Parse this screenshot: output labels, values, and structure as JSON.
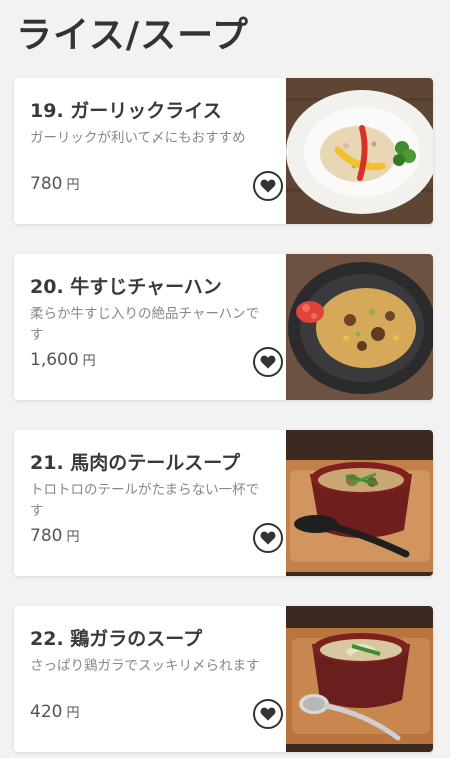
{
  "page": {
    "title": "ライス/スープ"
  },
  "menu": {
    "items": [
      {
        "name": "19. ガーリックライス",
        "description": "ガーリックが利いて〆にもおすすめ",
        "price": "780",
        "unit": "円",
        "photo": "garlic-rice-photo",
        "fav_icon": "heart-icon"
      },
      {
        "name": "20. 牛すじチャーハン",
        "description": "柔らか牛すじ入りの絶品チャーハンです",
        "price": "1,600",
        "unit": "円",
        "photo": "beef-fried-rice-photo",
        "fav_icon": "heart-icon"
      },
      {
        "name": "21. 馬肉のテールスープ",
        "description": "トロトロのテールがたまらない一杯です",
        "price": "780",
        "unit": "円",
        "photo": "horse-tail-soup-photo",
        "fav_icon": "heart-icon"
      },
      {
        "name": "22. 鶏ガラのスープ",
        "description": "さっぱり鶏ガラでスッキリ〆られます",
        "price": "420",
        "unit": "円",
        "photo": "chicken-soup-photo",
        "fav_icon": "heart-icon"
      }
    ]
  },
  "colors": {
    "background": "#f2f2f2",
    "card": "#ffffff",
    "title": "#333333",
    "description": "#888888",
    "heart": "#333333"
  }
}
